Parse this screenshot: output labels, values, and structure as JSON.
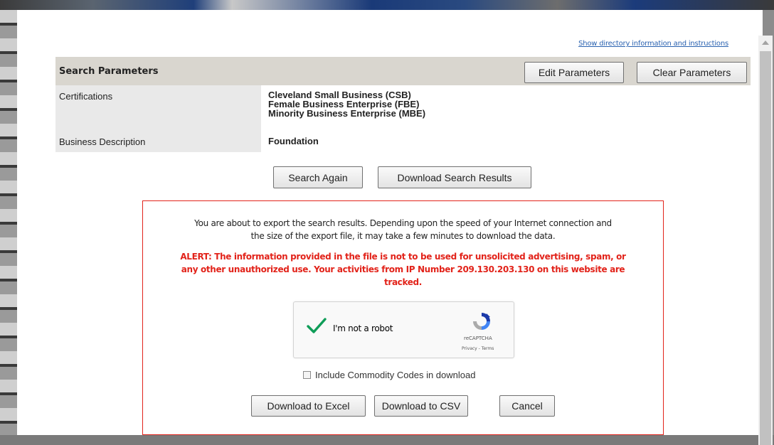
{
  "help_link": "Show directory information and instructions",
  "search_params": {
    "title": "Search Parameters",
    "edit_label": "Edit Parameters",
    "clear_label": "Clear Parameters",
    "rows": [
      {
        "label": "Certifications",
        "values": [
          "Cleveland Small Business (CSB)",
          "Female Business Enterprise (FBE)",
          "Minority Business Enterprise (MBE)"
        ]
      },
      {
        "label": "Business Description",
        "values": [
          "Foundation"
        ]
      }
    ]
  },
  "actions": {
    "search_again": "Search Again",
    "download_results": "Download Search Results"
  },
  "export": {
    "message_line1": "You are about to export the search results. Depending upon the speed of your Internet connection and",
    "message_line2": "the size of the export file, it may take a few minutes to download the data.",
    "alert_line1": "ALERT: The information provided in the file is not to be used for unsolicited advertising, spam, or",
    "alert_line2": "any other unauthorized use. Your activities from IP Number 209.130.203.130 on this website are",
    "alert_line3": "tracked.",
    "captcha_label": "I'm not a robot",
    "recaptcha_brand": "reCAPTCHA",
    "recaptcha_terms": "Privacy - Terms",
    "commodity_label": "Include Commodity Codes in download",
    "commodity_checked": false,
    "excel_label": "Download to Excel",
    "csv_label": "Download to CSV",
    "cancel_label": "Cancel"
  },
  "colors": {
    "alert": "#e2231a",
    "link": "#2a62b0",
    "header_bg": "#d9d6cf",
    "check_green": "#0f9d58"
  }
}
